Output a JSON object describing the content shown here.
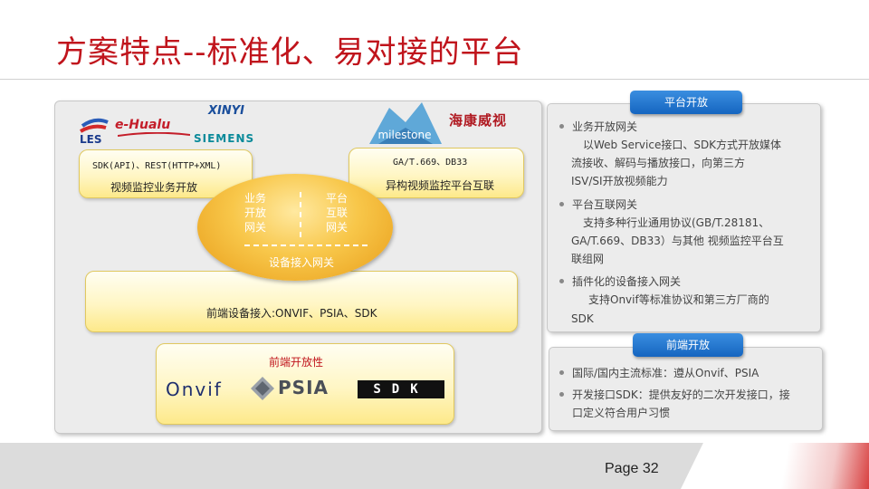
{
  "slide": {
    "title": "方案特点--标准化、易对接的平台",
    "page_label": "Page 32"
  },
  "diagram": {
    "logos": {
      "les": "LES",
      "ehualu": "e-Hualu",
      "xinyi": "XINYI",
      "siemens": "SIEMENS",
      "milestone": "milestone",
      "hikvision": "海康威视"
    },
    "left_box": {
      "protocols": "SDK(API)、REST(HTTP+XML)",
      "label": "视频监控业务开放"
    },
    "right_box": {
      "protocols": "GA/T.669、DB33",
      "label": "异构视频监控平台互联"
    },
    "gateway": {
      "left": [
        "业务",
        "开放",
        "网关"
      ],
      "right": [
        "平台",
        "互联",
        "网关"
      ],
      "bottom": "设备接入网关"
    },
    "front_access": "前端设备接入:ONVIF、PSIA、SDK",
    "front_open": {
      "title": "前端开放性",
      "logos": {
        "onvif": "Onvif",
        "psia": "PSIA",
        "sdk": "SDK"
      }
    }
  },
  "platform_open": {
    "tag": "平台开放",
    "items": [
      {
        "head": "业务开放网关",
        "lines": [
          "以Web Service接口、SDK方式开放媒体",
          "流接收、解码与播放接口，向第三方",
          "ISV/SI开放视频能力"
        ]
      },
      {
        "head": "平台互联网关",
        "lines": [
          "支持多种行业通用协议(GB/T.28181、",
          "GA/T.669、DB33）与其他 视频监控平台互",
          "联组网"
        ]
      },
      {
        "head": "插件化的设备接入网关",
        "lines": [
          "支持Onvif等标准协议和第三方厂商的",
          "SDK"
        ]
      }
    ]
  },
  "front_open_panel": {
    "tag": "前端开放",
    "items": [
      {
        "lines": [
          "国际/国内主流标准：遵从Onvif、PSIA"
        ]
      },
      {
        "lines": [
          "开发接口SDK：提供友好的二次开发接口，接",
          "口定义符合用户习惯"
        ]
      }
    ]
  },
  "colors": {
    "title": "#c0141c",
    "tag": "#1565c0",
    "ellipse": "#f0b030",
    "box": "#fff6c4"
  }
}
